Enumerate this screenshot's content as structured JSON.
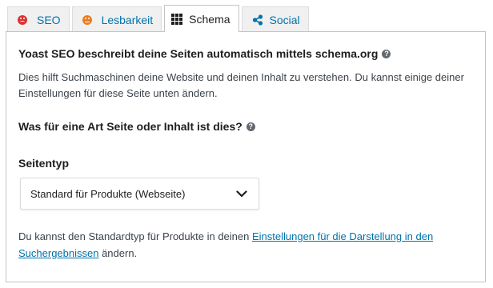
{
  "tabs": [
    {
      "label": "SEO",
      "icon": "sad-face-icon",
      "color": "#dc3232"
    },
    {
      "label": "Lesbarkeit",
      "icon": "neutral-face-icon",
      "color": "#ee7c1b"
    },
    {
      "label": "Schema",
      "icon": "grid-icon",
      "active": true
    },
    {
      "label": "Social",
      "icon": "share-icon"
    }
  ],
  "schema": {
    "headline": "Yoast SEO beschreibt deine Seiten automatisch mittels schema.org",
    "description": "Dies hilft Suchmaschinen deine Website und deinen Inhalt zu verstehen. Du kannst einige deiner Einstellungen für diese Seite unten ändern.",
    "question": "Was für eine Art Seite oder Inhalt ist dies?",
    "page_type_label": "Seitentyp",
    "page_type_value": "Standard für Produkte (Webseite)",
    "footer_prefix": "Du kannst den Standardtyp für Produkte in deinen ",
    "footer_link": "Einstellungen für die Darstellung in den Suchergebnissen",
    "footer_suffix": " ändern."
  },
  "colors": {
    "link": "#0073aa",
    "tab_background": "#f0f0f1",
    "border": "#c3c4c7"
  }
}
